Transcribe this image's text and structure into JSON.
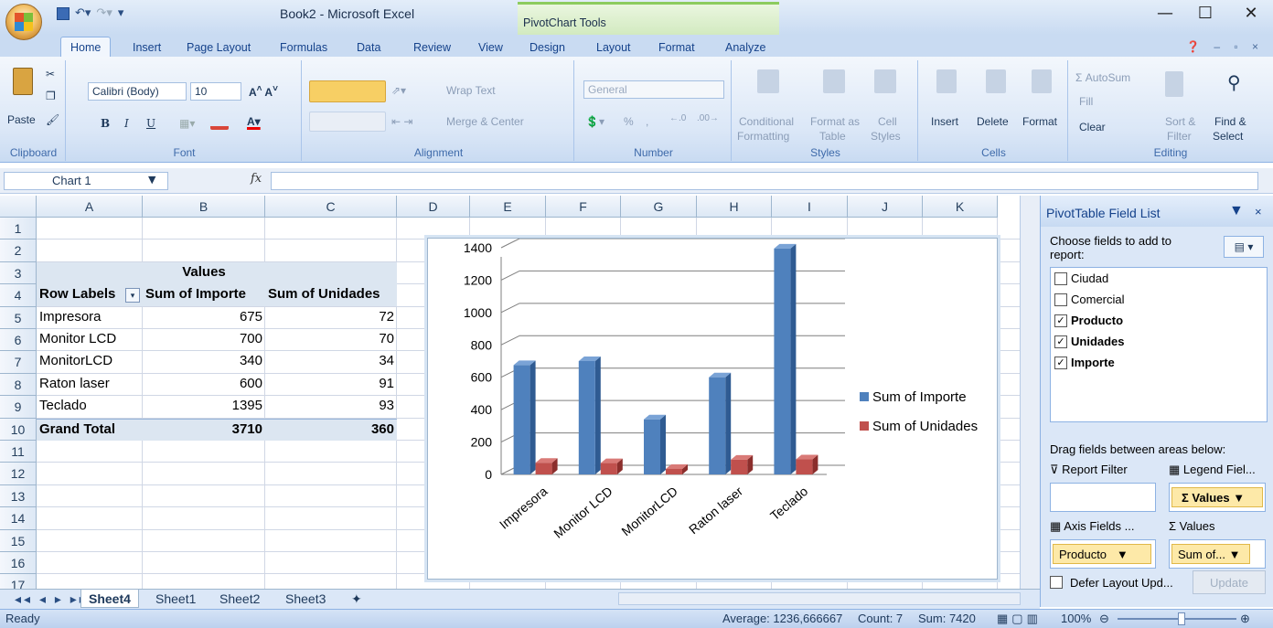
{
  "window": {
    "title": "Book2 - Microsoft Excel",
    "context_tab_title": "PivotChart Tools",
    "minimize": "—",
    "maximize": "☐",
    "close": "✕"
  },
  "ribbon_tabs": [
    "Home",
    "Insert",
    "Page Layout",
    "Formulas",
    "Data",
    "Review",
    "View",
    "Design",
    "Layout",
    "Format",
    "Analyze"
  ],
  "ribbon": {
    "clipboard": {
      "label": "Clipboard",
      "paste": "Paste"
    },
    "font": {
      "label": "Font",
      "name": "Calibri (Body)",
      "size": "10",
      "bold": "B",
      "italic": "I",
      "underline": "U"
    },
    "alignment": {
      "label": "Alignment",
      "wrap_text": "Wrap Text",
      "merge_center": "Merge & Center"
    },
    "number": {
      "label": "Number",
      "format": "General",
      "percent": "%",
      "comma": ","
    },
    "styles": {
      "label": "Styles",
      "conditional": "Conditional",
      "conditional2": "Formatting",
      "format_as": "Format as",
      "format_as2": "Table",
      "cell": "Cell",
      "cell2": "Styles"
    },
    "cells": {
      "label": "Cells",
      "insert": "Insert",
      "delete": "Delete",
      "format": "Format"
    },
    "editing": {
      "label": "Editing",
      "autosum": "AutoSum",
      "fill": "Fill",
      "clear": "Clear",
      "sort": "Sort &",
      "sort2": "Filter",
      "find": "Find &",
      "find2": "Select"
    }
  },
  "formula_bar": {
    "name_box": "Chart 1",
    "fx": "fx",
    "value": ""
  },
  "columns": [
    "A",
    "B",
    "C",
    "D",
    "E",
    "F",
    "G",
    "H",
    "I",
    "J",
    "K"
  ],
  "rows": [
    "1",
    "2",
    "3",
    "4",
    "5",
    "6",
    "7",
    "8",
    "9",
    "10",
    "11",
    "12",
    "13",
    "14",
    "15",
    "16",
    "17"
  ],
  "pivot": {
    "values_header": "Values",
    "row_labels": "Row Labels",
    "col1": "Sum of Importe",
    "col2": "Sum of Unidades",
    "rows": [
      {
        "label": "Impresora",
        "importe": "675",
        "unidades": "72"
      },
      {
        "label": "Monitor LCD",
        "importe": "700",
        "unidades": "70"
      },
      {
        "label": "MonitorLCD",
        "importe": "340",
        "unidades": "34"
      },
      {
        "label": "Raton laser",
        "importe": "600",
        "unidades": "91"
      },
      {
        "label": "Teclado",
        "importe": "1395",
        "unidades": "93"
      }
    ],
    "grand_total": {
      "label": "Grand Total",
      "importe": "3710",
      "unidades": "360"
    }
  },
  "chart_data": {
    "type": "bar",
    "categories": [
      "Impresora",
      "Monitor LCD",
      "MonitorLCD",
      "Raton laser",
      "Teclado"
    ],
    "series": [
      {
        "name": "Sum of Importe",
        "values": [
          675,
          700,
          340,
          600,
          1395
        ],
        "color": "#4f81bd"
      },
      {
        "name": "Sum of Unidades",
        "values": [
          72,
          70,
          34,
          91,
          93
        ],
        "color": "#c0504d"
      }
    ],
    "ylim": [
      0,
      1400
    ],
    "yticks": [
      "0",
      "200",
      "400",
      "600",
      "800",
      "1000",
      "1200",
      "1400"
    ],
    "legend_position": "right",
    "grid": true
  },
  "field_list": {
    "title": "PivotTable Field List",
    "choose_label": "Choose fields to add to report:",
    "fields": [
      {
        "name": "Ciudad",
        "checked": false
      },
      {
        "name": "Comercial",
        "checked": false
      },
      {
        "name": "Producto",
        "checked": true
      },
      {
        "name": "Unidades",
        "checked": true
      },
      {
        "name": "Importe",
        "checked": true
      }
    ],
    "drag_label": "Drag fields between areas below:",
    "report_filter": "Report Filter",
    "legend_fields": "Legend Fiel...",
    "values_chip": "Σ Values",
    "axis_fields": "Axis Fields ...",
    "values_area": "Values",
    "producto_chip": "Producto",
    "sum_chip": "Sum of...",
    "defer_label": "Defer Layout Upd...",
    "update_button": "Update"
  },
  "sheet_tabs": [
    "Sheet4",
    "Sheet1",
    "Sheet2",
    "Sheet3"
  ],
  "status": {
    "ready": "Ready",
    "average": "Average: 1236,666667",
    "count": "Count: 7",
    "sum": "Sum: 7420",
    "zoom": "100%"
  }
}
